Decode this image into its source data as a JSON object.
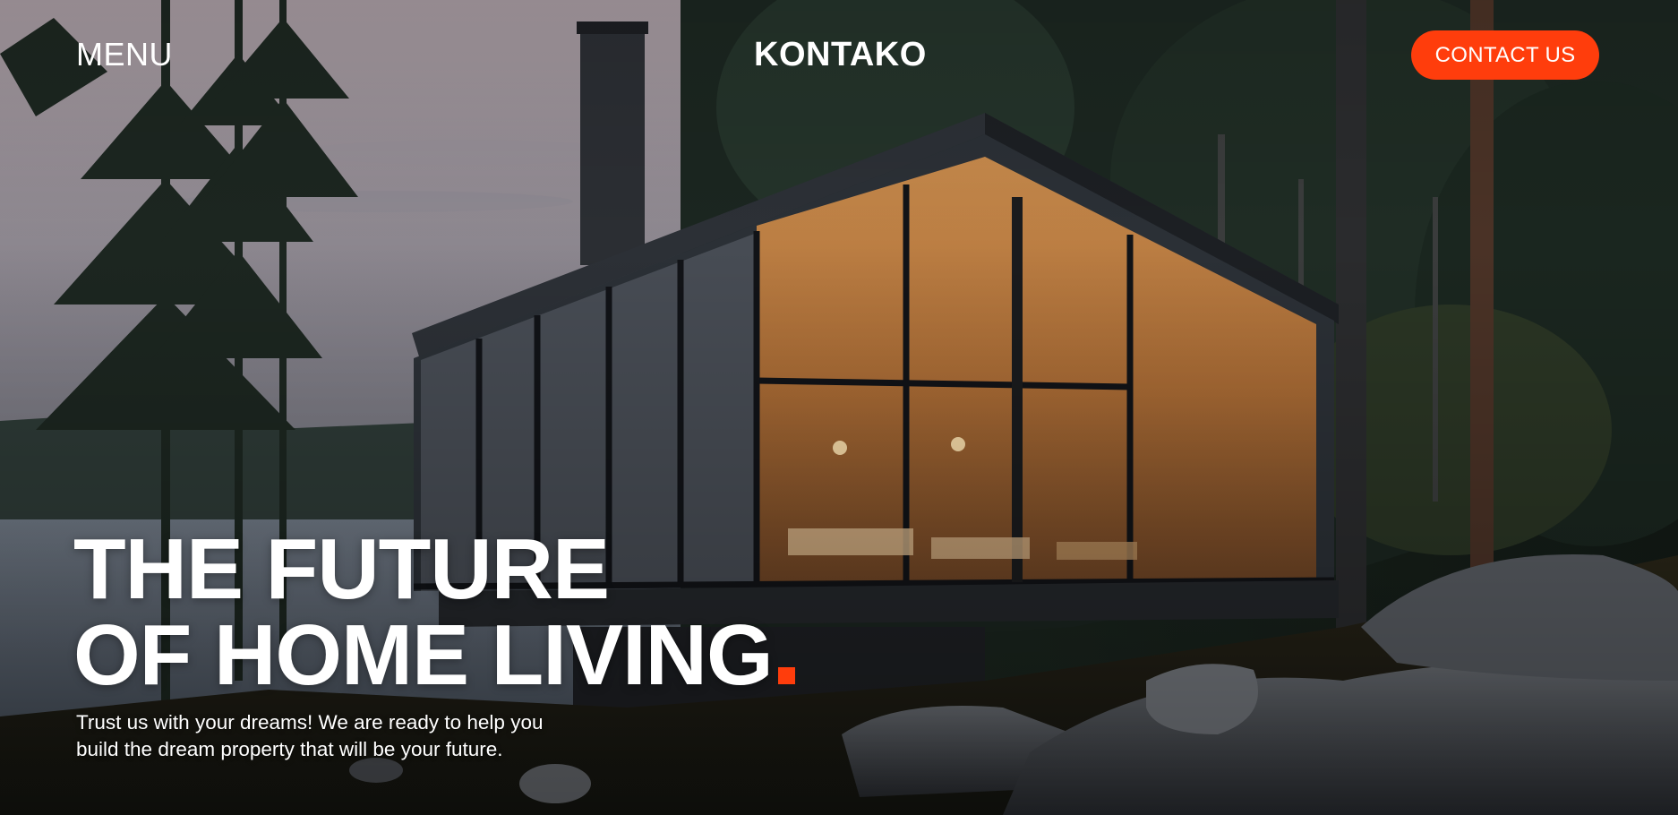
{
  "header": {
    "menu_label": "MENU",
    "brand": "KONTAKO",
    "contact_label": "CONTACT US"
  },
  "hero": {
    "headline_line1": "THE FUTURE",
    "headline_line2": "OF HOME LIVING",
    "subtext_line1": "Trust us with your dreams! We are ready to help you",
    "subtext_line2": "build the dream property that will be your future.",
    "image_subject": "modern glass cabin in pine forest by lake at dusk"
  },
  "colors": {
    "accent": "#ff3d0c",
    "text": "#ffffff"
  }
}
